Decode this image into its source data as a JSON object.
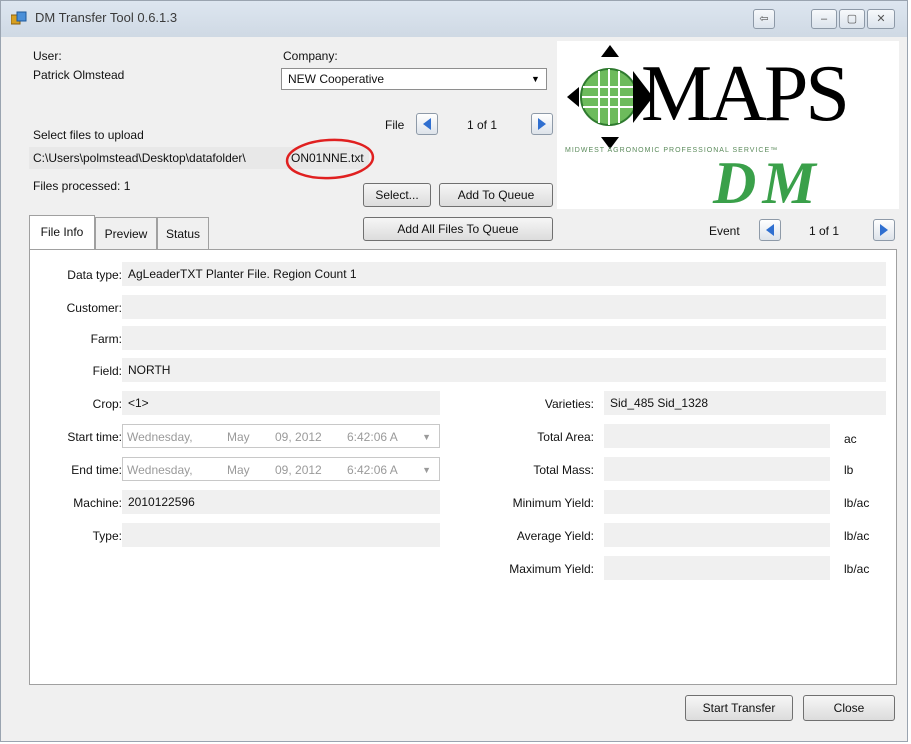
{
  "window": {
    "title": "DM Transfer Tool 0.6.1.3",
    "title_buttons": [
      "⇦",
      "–",
      "▢",
      "✕"
    ]
  },
  "user": {
    "label": "User:",
    "name": "Patrick Olmstead"
  },
  "company": {
    "label": "Company:",
    "selected": "NEW Cooperative"
  },
  "file_nav": {
    "label": "File",
    "counter": "1 of 1"
  },
  "upload": {
    "select_label": "Select files to upload",
    "path": "C:\\Users\\polmstead\\Desktop\\datafolder\\",
    "filename": "ON01NNE.txt",
    "processed": "Files processed: 1"
  },
  "buttons": {
    "select": "Select...",
    "add_to_queue": "Add To Queue",
    "add_all": "Add All Files To Queue",
    "start_transfer": "Start Transfer",
    "close": "Close"
  },
  "logo": {
    "maps": "MAPS",
    "tagline": "MIDWEST AGRONOMIC PROFESSIONAL SERVICE™",
    "dm": "DM"
  },
  "tabs": [
    "File Info",
    "Preview",
    "Status"
  ],
  "event_nav": {
    "label": "Event",
    "counter": "1 of 1"
  },
  "info": {
    "data_type": {
      "label": "Data type:",
      "value": "AgLeaderTXT Planter File. Region Count 1"
    },
    "customer": {
      "label": "Customer:",
      "value": ""
    },
    "farm": {
      "label": "Farm:",
      "value": ""
    },
    "field": {
      "label": "Field:",
      "value": "NORTH"
    },
    "crop": {
      "label": "Crop:",
      "value": "<1>"
    },
    "start_time": {
      "label": "Start time:",
      "day": "Wednesday,",
      "month": "May",
      "date": "09, 2012",
      "time": "6:42:06 A"
    },
    "end_time": {
      "label": "End time:",
      "day": "Wednesday,",
      "month": "May",
      "date": "09, 2012",
      "time": "6:42:06 A"
    },
    "machine": {
      "label": "Machine:",
      "value": "2010122596"
    },
    "type": {
      "label": "Type:",
      "value": ""
    },
    "varieties": {
      "label": "Varieties:",
      "value": "Sid_485 Sid_1328"
    },
    "total_area": {
      "label": "Total Area:",
      "value": "",
      "unit": "ac"
    },
    "total_mass": {
      "label": "Total Mass:",
      "value": "",
      "unit": "lb"
    },
    "min_yield": {
      "label": "Minimum Yield:",
      "value": "",
      "unit": "lb/ac"
    },
    "avg_yield": {
      "label": "Average Yield:",
      "value": "",
      "unit": "lb/ac"
    },
    "max_yield": {
      "label": "Maximum Yield:",
      "value": "",
      "unit": "lb/ac"
    }
  },
  "colors": {
    "annotation": "#e02020",
    "logo_green": "#3aa04a",
    "nav_arrow": "#2f6fd0"
  }
}
